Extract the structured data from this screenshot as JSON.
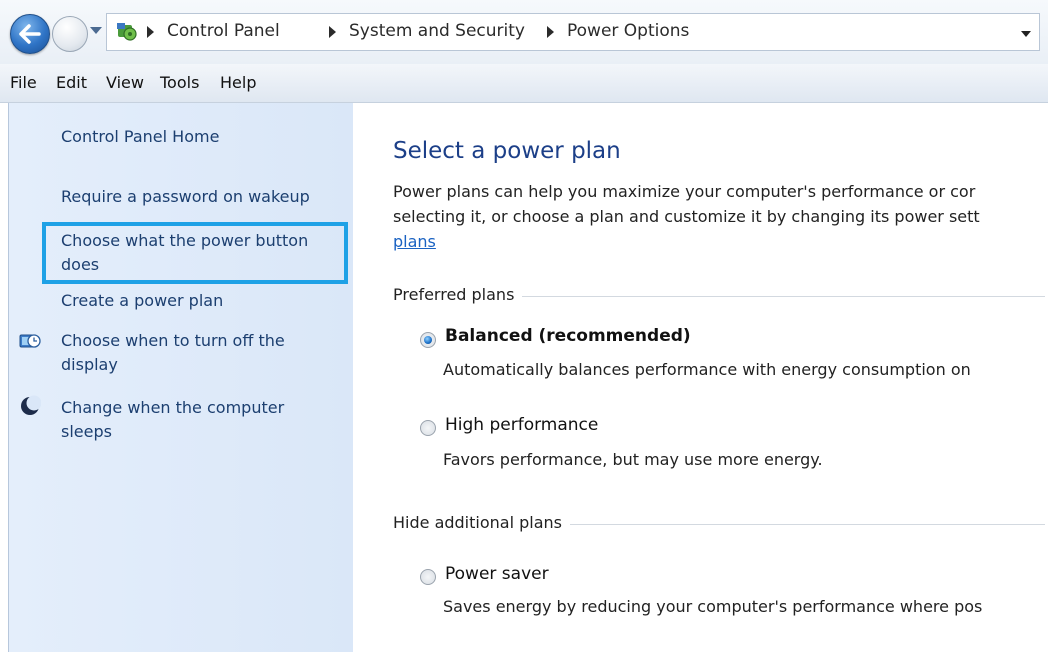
{
  "address_bar": {
    "breadcrumbs": [
      "Control Panel",
      "System and Security",
      "Power Options"
    ]
  },
  "menu": {
    "items": [
      "File",
      "Edit",
      "View",
      "Tools",
      "Help"
    ]
  },
  "sidebar": {
    "home": "Control Panel Home",
    "links": [
      {
        "label": "Require a password on wakeup"
      },
      {
        "label_line1": "Choose what the power button",
        "label_line2": "does"
      },
      {
        "label": "Create a power plan"
      },
      {
        "label_line1": "Choose when to turn off the",
        "label_line2": "display",
        "icon": "monitor-clock-icon"
      },
      {
        "label_line1": "Change when the computer",
        "label_line2": "sleeps",
        "icon": "moon-icon"
      }
    ],
    "highlight_color": "#1ea1e6"
  },
  "main": {
    "title": "Select a power plan",
    "intro_line1": "Power plans can help you maximize your computer's performance or cor",
    "intro_line2": "selecting it, or choose a plan and customize it by changing its power sett",
    "intro_link": "plans",
    "preferred_label": "Preferred plans",
    "additional_label": "Hide additional plans",
    "plans": [
      {
        "name": "Balanced (recommended)",
        "selected": true,
        "desc": "Automatically balances performance with energy consumption on"
      },
      {
        "name": "High performance",
        "selected": false,
        "desc": "Favors performance, but may use more energy."
      },
      {
        "name": "Power saver",
        "selected": false,
        "desc": "Saves energy by reducing your computer's performance where pos"
      }
    ]
  }
}
